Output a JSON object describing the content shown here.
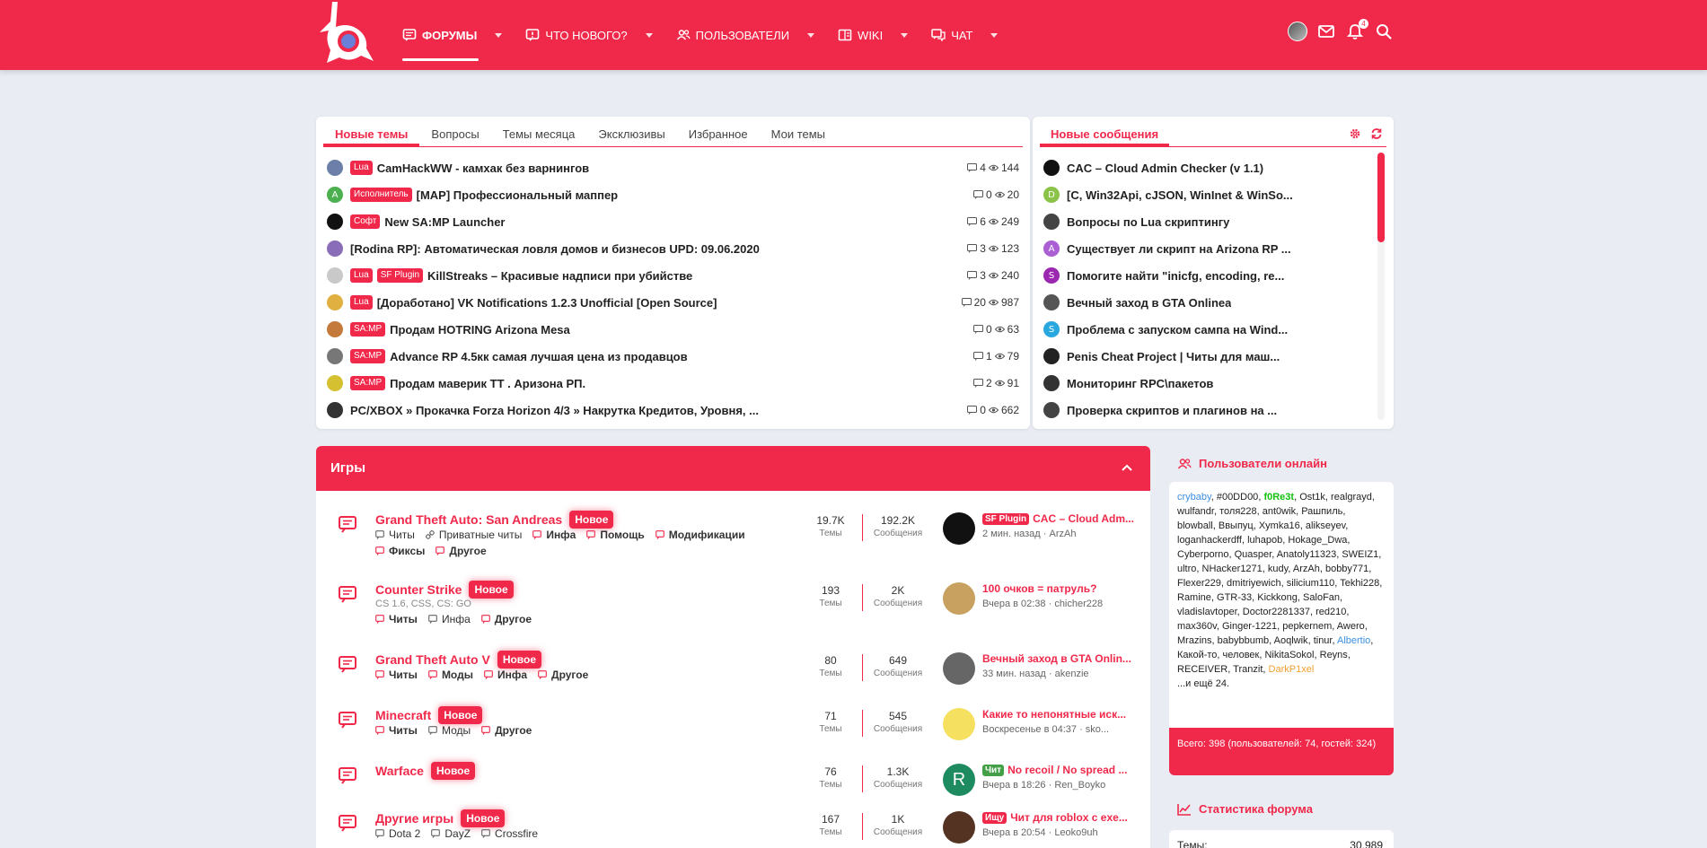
{
  "colors": {
    "accent": "#f0284a",
    "background": "#e9ecf3"
  },
  "header": {
    "nav": [
      {
        "label": "ФОРУМЫ",
        "icon": "forum-icon",
        "active": true
      },
      {
        "label": "ЧТО НОВОГО?",
        "icon": "whats-new-icon"
      },
      {
        "label": "ПОЛЬЗОВАТЕЛИ",
        "icon": "users-icon"
      },
      {
        "label": "WIKI",
        "icon": "wiki-icon"
      },
      {
        "label": "ЧАТ",
        "icon": "chat-icon"
      }
    ],
    "notifications_count": "4"
  },
  "new_topics": {
    "tabs": [
      "Новые темы",
      "Вопросы",
      "Темы месяца",
      "Эксклюзивы",
      "Избранное",
      "Мои темы"
    ],
    "items": [
      {
        "prefixes": [
          "Lua"
        ],
        "title": "CamHackWW - камхак без варнингов",
        "replies": "4",
        "views": "144"
      },
      {
        "prefixes": [
          "Исполнитель"
        ],
        "title": "[MAP] Профессиональный маппер",
        "replies": "0",
        "views": "20",
        "avatar_letter": "A"
      },
      {
        "prefixes": [
          "Софт"
        ],
        "title": "New SA:MP Launcher",
        "replies": "6",
        "views": "249"
      },
      {
        "prefixes": [],
        "title": "[Rodina RP]: Автоматическая ловля домов и бизнесов UPD: 09.06.2020",
        "replies": "3",
        "views": "123"
      },
      {
        "prefixes": [
          "Lua",
          "SF Plugin"
        ],
        "title": "KillStreaks – Красивые надписи при убийстве",
        "replies": "3",
        "views": "240"
      },
      {
        "prefixes": [
          "Lua"
        ],
        "title": "[Доработано] VK Notifications 1.2.3 Unofficial [Open Source]",
        "replies": "20",
        "views": "987"
      },
      {
        "prefixes": [
          "SA:MP"
        ],
        "title": "Продам HOTRING Arizona Mesa",
        "replies": "0",
        "views": "63"
      },
      {
        "prefixes": [
          "SA:MP"
        ],
        "title": "Advance RP 4.5кк самая лучшая цена из продавцов",
        "replies": "1",
        "views": "79"
      },
      {
        "prefixes": [
          "SA:MP"
        ],
        "title": "Продам маверик TT . Аризона РП.",
        "replies": "2",
        "views": "91"
      },
      {
        "prefixes": [],
        "title": "PC/XBOX » Прокачка Forza Horizon 4/3 » Накрутка Кредитов, Уровня, ...",
        "replies": "0",
        "views": "662"
      }
    ]
  },
  "new_posts": {
    "tab": "Новые сообщения",
    "items": [
      {
        "title": "CAC – Cloud Admin Checker (v 1.1)"
      },
      {
        "title": "[C, Win32Api, cJSON, WinInet & WinSo...",
        "avatar_letter": "D"
      },
      {
        "title": "Вопросы по Lua скриптингу"
      },
      {
        "title": "Существует ли скрипт на Arizona RP ...",
        "avatar_letter": "A"
      },
      {
        "title": "Помогите найти \"inicfg, encoding, re...",
        "avatar_letter": "S"
      },
      {
        "title": "Вечный заход в GTA Onlinea"
      },
      {
        "title": "Проблема с запуском сампа на Wind...",
        "avatar_letter": "S"
      },
      {
        "title": "Penis Cheat Project | Читы для маш..."
      },
      {
        "title": "Мониторинг RPC\\пакетов"
      },
      {
        "title": "Проверка скриптов и плагинов на ..."
      }
    ]
  },
  "games": {
    "title": "Игры",
    "new_label": "Новое",
    "topics_label": "Темы",
    "posts_label": "Сообщения",
    "nodes": [
      {
        "title": "Grand Theft Auto: San Andreas",
        "subs": [
          {
            "label": "Читы",
            "bold": false,
            "icon": "forum-icon"
          },
          {
            "label": "Приватные читы",
            "bold": false,
            "icon": "link-icon"
          },
          {
            "label": "Инфа",
            "bold": true,
            "icon": "forum-icon"
          },
          {
            "label": "Помощь",
            "bold": true,
            "icon": "forum-icon"
          },
          {
            "label": "Модификации",
            "bold": true,
            "icon": "forum-icon"
          },
          {
            "label": "Фиксы",
            "bold": true,
            "icon": "forum-icon"
          },
          {
            "label": "Другое",
            "bold": true,
            "icon": "forum-icon"
          }
        ],
        "topics": "19.7K",
        "posts": "192.2K",
        "last_prefix": "SF Plugin",
        "last_title": "CAC – Cloud Adm...",
        "last_meta": "2 мин. назад · ArzAh"
      },
      {
        "title": "Counter Strike",
        "desc": "CS 1.6, CSS, CS: GO",
        "subs": [
          {
            "label": "Читы",
            "bold": true,
            "icon": "forum-icon"
          },
          {
            "label": "Инфа",
            "bold": false,
            "icon": "forum-icon"
          },
          {
            "label": "Другое",
            "bold": true,
            "icon": "forum-icon"
          }
        ],
        "topics": "193",
        "posts": "2K",
        "last_title": "100 очков = патруль?",
        "last_meta": "Вчера в 02:38 · chicher228"
      },
      {
        "title": "Grand Theft Auto V",
        "subs": [
          {
            "label": "Читы",
            "bold": true,
            "icon": "forum-icon"
          },
          {
            "label": "Моды",
            "bold": true,
            "icon": "forum-icon"
          },
          {
            "label": "Инфа",
            "bold": true,
            "icon": "forum-icon"
          },
          {
            "label": "Другое",
            "bold": true,
            "icon": "forum-icon"
          }
        ],
        "topics": "80",
        "posts": "649",
        "last_title": "Вечный заход в GTA Onlin...",
        "last_meta": "33 мин. назад · akenzie"
      },
      {
        "title": "Minecraft",
        "subs": [
          {
            "label": "Читы",
            "bold": true,
            "icon": "forum-icon"
          },
          {
            "label": "Моды",
            "bold": false,
            "icon": "forum-icon"
          },
          {
            "label": "Другое",
            "bold": true,
            "icon": "forum-icon"
          }
        ],
        "topics": "71",
        "posts": "545",
        "last_title": "Какие то непонятные иск...",
        "last_meta": "Воскресенье в 04:37 · sko..."
      },
      {
        "title": "Warface",
        "subs": [],
        "topics": "76",
        "posts": "1.3K",
        "last_prefix": "Чит",
        "last_title": "No recoil / No spread ...",
        "last_meta": "Вчера в 18:26 · Ren_Boyko",
        "last_avatar_letter": "R"
      },
      {
        "title": "Другие игры",
        "subs": [
          {
            "label": "Dota 2",
            "bold": false,
            "icon": "forum-icon"
          },
          {
            "label": "DayZ",
            "bold": false,
            "icon": "forum-icon"
          },
          {
            "label": "Crossfire",
            "bold": false,
            "icon": "forum-icon"
          }
        ],
        "topics": "167",
        "posts": "1K",
        "last_prefix": "Ищу",
        "last_title": "Чит для roblox с exe...",
        "last_meta": "Вчера в 20:54 · Leoko9uh"
      }
    ]
  },
  "sidebar": {
    "online_title": "Пользователи онлайн",
    "online_users": [
      {
        "n": "crybaby",
        "c": "blue"
      },
      {
        "n": "#00DD00"
      },
      {
        "n": "f0Re3t",
        "c": "green"
      },
      {
        "n": "Ost1k"
      },
      {
        "n": "realgrayd"
      },
      {
        "n": "wulfandr"
      },
      {
        "n": "толя228"
      },
      {
        "n": "ant0wik"
      },
      {
        "n": "Рашпиль"
      },
      {
        "n": "blowball"
      },
      {
        "n": "Ввыпуц"
      },
      {
        "n": "Xymka16"
      },
      {
        "n": "alikseyev"
      },
      {
        "n": "loganhackerdff"
      },
      {
        "n": "luhapob"
      },
      {
        "n": "Hokage_Dwa"
      },
      {
        "n": "Cyberporno"
      },
      {
        "n": "Quasper"
      },
      {
        "n": "Anatoly11323"
      },
      {
        "n": "SWEIZ1"
      },
      {
        "n": "ultro"
      },
      {
        "n": "NHacker1271"
      },
      {
        "n": "kudy"
      },
      {
        "n": "ArzAh"
      },
      {
        "n": "bobby771"
      },
      {
        "n": "Flexer229"
      },
      {
        "n": "dmitriyewich"
      },
      {
        "n": "silicium110"
      },
      {
        "n": "Tekhi228"
      },
      {
        "n": "Ramine"
      },
      {
        "n": "GTR-33"
      },
      {
        "n": "Kickkong"
      },
      {
        "n": "SaloFan"
      },
      {
        "n": "vladislavtoper"
      },
      {
        "n": "Doctor2281337"
      },
      {
        "n": "red210"
      },
      {
        "n": "max360v"
      },
      {
        "n": "Ginger-1221"
      },
      {
        "n": "pepkernem"
      },
      {
        "n": "Awero"
      },
      {
        "n": "Mrazins"
      },
      {
        "n": "babybbumb"
      },
      {
        "n": "Aoqlwik"
      },
      {
        "n": "tinur"
      },
      {
        "n": "Albertio",
        "c": "blue"
      },
      {
        "n": "Какой-то"
      },
      {
        "n": "человек"
      },
      {
        "n": "NikitaSokol"
      },
      {
        "n": "Reyns"
      },
      {
        "n": "RECEIVER"
      },
      {
        "n": "Tranzit"
      },
      {
        "n": "DarkP1xel",
        "c": "orange"
      }
    ],
    "online_more": "...и ещё 24.",
    "online_total": "Всего: 398 (пользователей: 74, гостей: 324)",
    "stats_title": "Статистика форума",
    "stats_row_label": "Темы:",
    "stats_row_value": "30,989"
  }
}
